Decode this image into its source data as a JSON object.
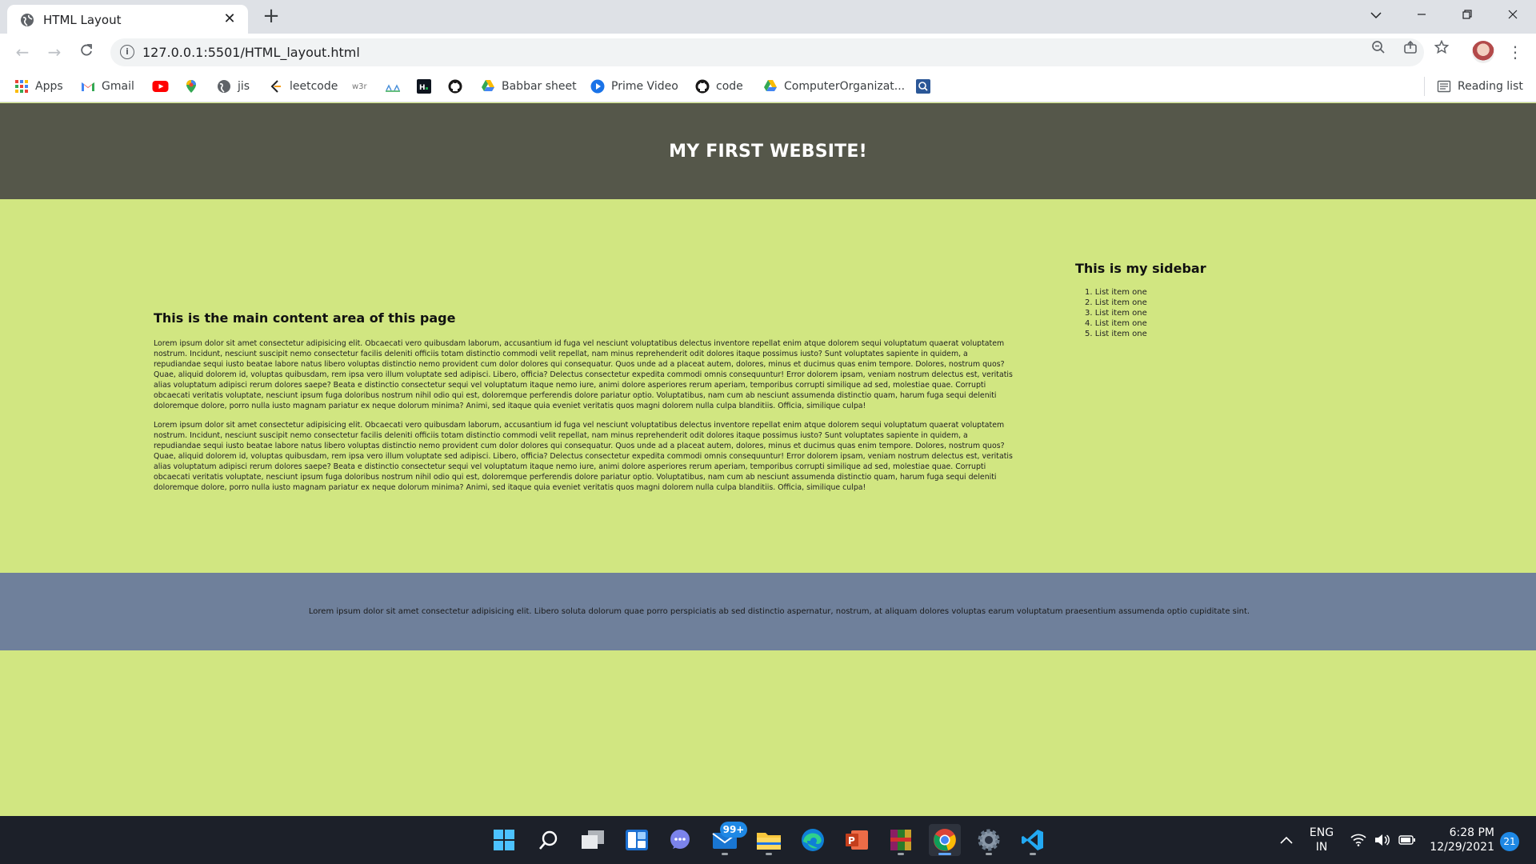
{
  "browser": {
    "tab_title": "HTML Layout",
    "url": "127.0.0.1:5501/HTML_layout.html",
    "bookmarks": [
      {
        "label": "Apps",
        "icon": "apps-grid-icon"
      },
      {
        "label": "Gmail",
        "icon": "gmail-icon"
      },
      {
        "label": "",
        "icon": "youtube-icon"
      },
      {
        "label": "",
        "icon": "maps-pin-icon"
      },
      {
        "label": "jis",
        "icon": "globe-icon"
      },
      {
        "label": "leetcode",
        "icon": "leetcode-icon"
      },
      {
        "label": "",
        "icon": "w3schools-icon"
      },
      {
        "label": "",
        "icon": "geeksforgeeks-icon"
      },
      {
        "label": "",
        "icon": "hackerrank-icon"
      },
      {
        "label": "",
        "icon": "github-icon"
      },
      {
        "label": "Babbar sheet",
        "icon": "google-drive-icon"
      },
      {
        "label": "Prime Video",
        "icon": "prime-video-icon"
      },
      {
        "label": "code",
        "icon": "github-icon"
      },
      {
        "label": "ComputerOrganizat...",
        "icon": "google-drive-icon"
      },
      {
        "label": "",
        "icon": "search-site-icon"
      }
    ],
    "reading_list": "Reading list"
  },
  "page": {
    "header_title": "MY FIRST WEBSITE!",
    "main_heading": "This is the main content area of this page",
    "paragraph_1": "Lorem ipsum dolor sit amet consectetur adipisicing elit. Obcaecati vero quibusdam laborum, accusantium id fuga vel nesciunt voluptatibus delectus inventore repellat enim atque dolorem sequi voluptatum quaerat voluptatem nostrum. Incidunt, nesciunt suscipit nemo consectetur facilis deleniti officiis totam distinctio commodi velit repellat, nam minus reprehenderit odit dolores itaque possimus iusto? Sunt voluptates sapiente in quidem, a repudiandae sequi iusto beatae labore natus libero voluptas distinctio nemo provident cum dolor dolores qui consequatur. Quos unde ad a placeat autem, dolores, minus et ducimus quas enim tempore. Dolores, nostrum quos? Quae, aliquid dolorem id, voluptas quibusdam, rem ipsa vero illum voluptate sed adipisci. Libero, officia? Delectus consectetur expedita commodi omnis consequuntur! Error dolorem ipsam, veniam nostrum delectus est, veritatis alias voluptatum adipisci rerum dolores saepe? Beata e distinctio consectetur sequi vel voluptatum itaque nemo iure, animi dolore asperiores rerum aperiam, temporibus corrupti similique ad sed, molestiae quae. Corrupti obcaecati veritatis voluptate, nesciunt ipsum fuga doloribus nostrum nihil odio qui est, doloremque perferendis dolore pariatur optio. Voluptatibus, nam cum ab nesciunt assumenda distinctio quam, harum fuga sequi deleniti doloremque dolore, porro nulla iusto magnam pariatur ex neque dolorum minima? Animi, sed itaque quia eveniet veritatis quos magni dolorem nulla culpa blanditiis. Officia, similique culpa!",
    "paragraph_2": "Lorem ipsum dolor sit amet consectetur adipisicing elit. Obcaecati vero quibusdam laborum, accusantium id fuga vel nesciunt voluptatibus delectus inventore repellat enim atque dolorem sequi voluptatum quaerat voluptatem nostrum. Incidunt, nesciunt suscipit nemo consectetur facilis deleniti officiis totam distinctio commodi velit repellat, nam minus reprehenderit odit dolores itaque possimus iusto? Sunt voluptates sapiente in quidem, a repudiandae sequi iusto beatae labore natus libero voluptas distinctio nemo provident cum dolor dolores qui consequatur. Quos unde ad a placeat autem, dolores, minus et ducimus quas enim tempore. Dolores, nostrum quos? Quae, aliquid dolorem id, voluptas quibusdam, rem ipsa vero illum voluptate sed adipisci. Libero, officia? Delectus consectetur expedita commodi omnis consequuntur! Error dolorem ipsam, veniam nostrum delectus est, veritatis alias voluptatum adipisci rerum dolores saepe? Beata e distinctio consectetur sequi vel voluptatum itaque nemo iure, animi dolore asperiores rerum aperiam, temporibus corrupti similique ad sed, molestiae quae. Corrupti obcaecati veritatis voluptate, nesciunt ipsum fuga doloribus nostrum nihil odio qui est, doloremque perferendis dolore pariatur optio. Voluptatibus, nam cum ab nesciunt assumenda distinctio quam, harum fuga sequi deleniti doloremque dolore, porro nulla iusto magnam pariatur ex neque dolorum minima? Animi, sed itaque quia eveniet veritatis quos magni dolorem nulla culpa blanditiis. Officia, similique culpa!",
    "sidebar_heading": "This is my sidebar",
    "sidebar_items": [
      "1. List item one",
      "2. List item one",
      "3. List item one",
      "4. List item one",
      "5. List item one"
    ],
    "footer_text": "Lorem ipsum dolor sit amet consectetur adipisicing elit. Libero soluta dolorum quae porro perspiciatis ab sed distinctio aspernatur, nostrum, at aliquam dolores voluptas earum voluptatum praesentium assumenda optio cupiditate sint."
  },
  "colors": {
    "header_bg": "#55574a",
    "body_bg": "#d1e681",
    "footer_bg": "#6f809b",
    "taskbar_bg": "#1c2029"
  },
  "taskbar": {
    "mail_badge": "99+",
    "language_line1": "ENG",
    "language_line2": "IN",
    "time": "6:28 PM",
    "date": "12/29/2021",
    "notification_count": "21",
    "icons": [
      "windows-start-icon",
      "search-icon",
      "task-view-icon",
      "widgets-icon",
      "teams-chat-icon",
      "mail-icon",
      "file-explorer-icon",
      "edge-icon",
      "powerpoint-icon",
      "winrar-icon",
      "chrome-icon",
      "settings-icon",
      "vscode-icon"
    ]
  }
}
